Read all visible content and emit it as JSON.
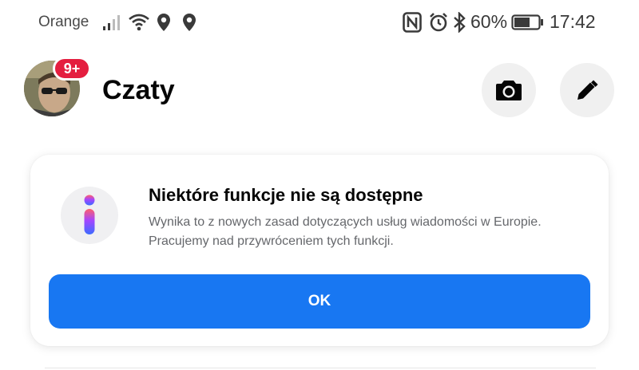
{
  "status_bar": {
    "carrier": "Orange",
    "battery_percent": "60%",
    "time": "17:42",
    "icons": [
      "signal-icon",
      "wifi-icon",
      "location-icon",
      "location-icon",
      "nfc-icon",
      "alarm-icon",
      "bluetooth-icon",
      "battery-icon"
    ]
  },
  "header": {
    "title": "Czaty",
    "badge_count": "9+",
    "icons": [
      "avatar",
      "camera-icon",
      "pencil-icon"
    ]
  },
  "notice": {
    "title": "Niektóre funkcje nie są dostępne",
    "body": "Wynika to z nowych zasad dotyczących usług wiadomości w Europie. Pracujemy nad przywróceniem tych funkcji.",
    "button_label": "OK",
    "icon": "info-icon"
  },
  "colors": {
    "primary_button": "#1877f2",
    "badge": "#e41e3f",
    "icon_button_bg": "#f0f0f0",
    "secondary_text": "#65676b"
  }
}
